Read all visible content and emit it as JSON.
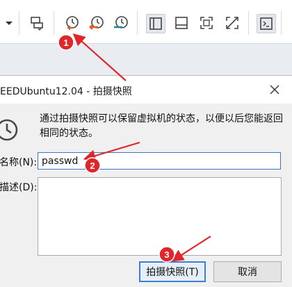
{
  "dialog": {
    "title": "EEDUbuntu12.04 - 拍摄快照",
    "description": "通过拍摄快照可以保留虚拟机的状态，以便以后您能返回相同的状态。",
    "name_label": "名称(N):",
    "name_value": "passwd",
    "desc_label": "描述(D):",
    "desc_value": "",
    "ok_label": "拍摄快照(T)",
    "cancel_label": "取消"
  },
  "annotations": [
    {
      "number": "1"
    },
    {
      "number": "2"
    },
    {
      "number": "3"
    }
  ],
  "colors": {
    "marker_red": "#e0262b",
    "focus_blue": "#3c7fd6",
    "toolbar_orange": "#e8541c",
    "toolbar_teal": "#1d8c9b"
  }
}
